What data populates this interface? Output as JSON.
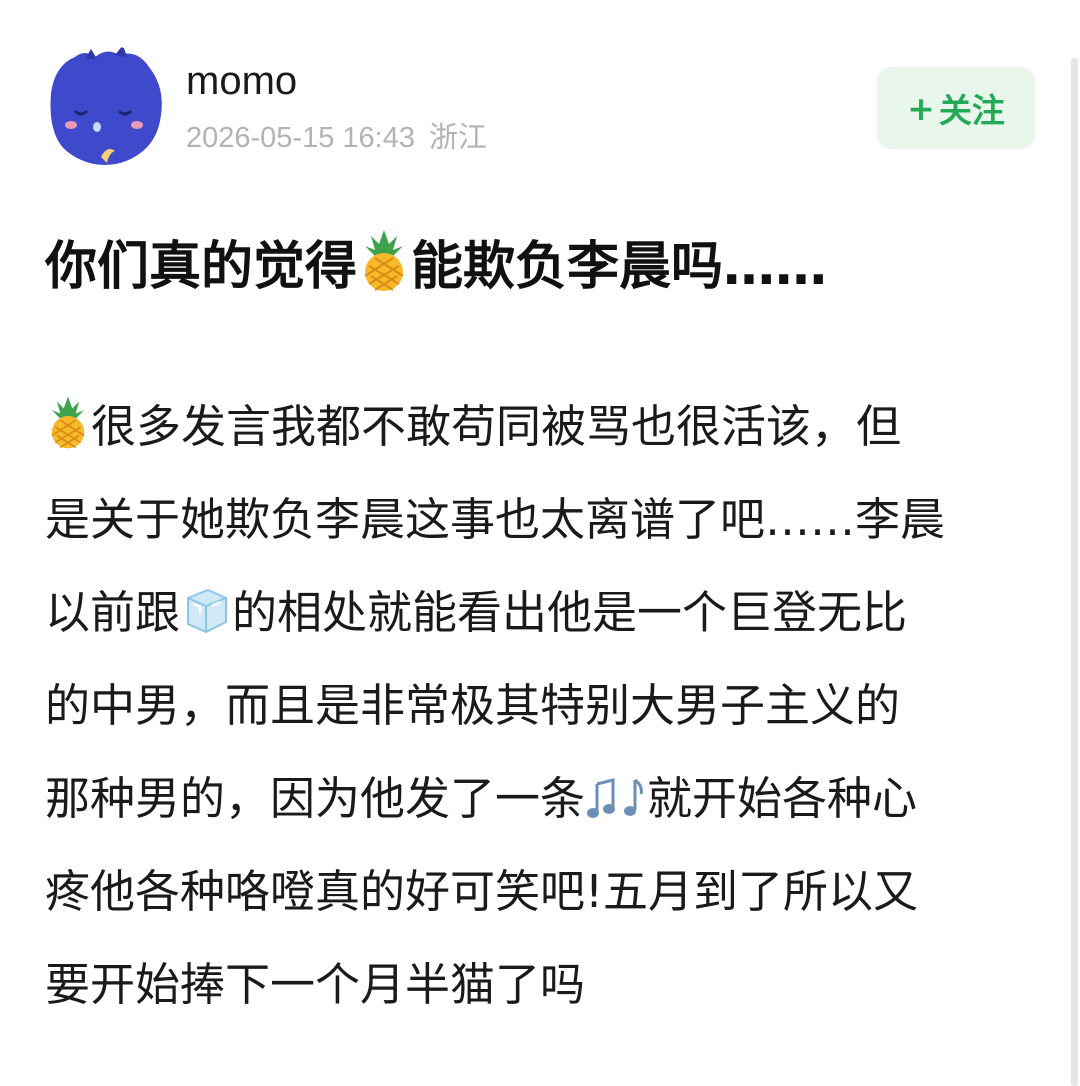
{
  "author": {
    "name": "momo",
    "timestamp": "2026-05-15 16:43",
    "location": "浙江",
    "avatar_icon": "sleeping-blue-cat-avatar"
  },
  "follow_button": {
    "plus": "+",
    "label": "关注",
    "color": "#23a957",
    "background": "#e8f6ec"
  },
  "post": {
    "title_before": "你们真的觉得",
    "title_emoji": "pineapple",
    "title_after": "能欺负李晨吗……",
    "content_lines": [
      {
        "emoji_before": "pineapple",
        "text": "很多发言我都不敢苟同被骂也很活该，但"
      },
      {
        "text": "是关于她欺负李晨这事也太离谱了吧……李晨"
      },
      {
        "text_before": "以前跟",
        "emoji": "ice-cube",
        "text_after": "的相处就能看出他是一个巨登无比"
      },
      {
        "text": "的中男，而且是非常极其特别大男子主义的"
      },
      {
        "text_before": "那种男的，因为他发了一条",
        "emoji": "music-notes",
        "text_after": "就开始各种心"
      },
      {
        "text": "疼他各种咯噔真的好可笑吧!五月到了所以又"
      },
      {
        "text": "要开始捧下一个月半猫了吗"
      }
    ]
  }
}
